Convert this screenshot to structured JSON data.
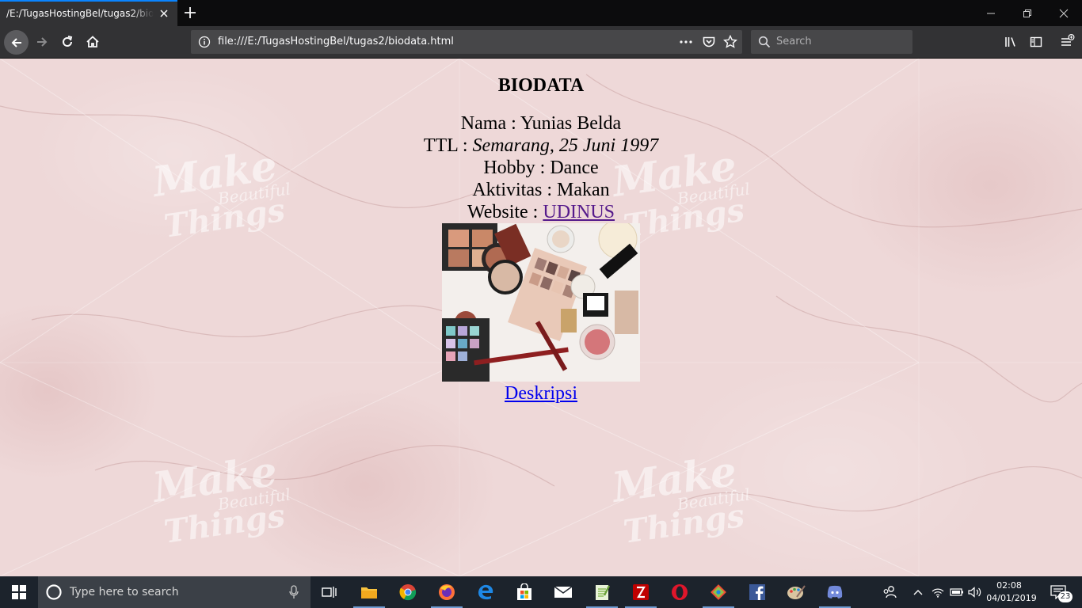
{
  "browser": {
    "tab_title": "/E:/TugasHostingBel/tugas2/biodata.html",
    "url": "file:///E:/TugasHostingBel/tugas2/biodata.html",
    "search_placeholder": "Search",
    "accent_color": "#0a84ff"
  },
  "page": {
    "title": "BIODATA",
    "nama_label": "Nama : ",
    "nama_value": "Yunias Belda",
    "ttl_label": "TTL : ",
    "ttl_value": "Semarang, 25 Juni 1997",
    "hobby_label": "Hobby : ",
    "hobby_value": "Dance",
    "aktivitas_label": "Aktivitas : ",
    "aktivitas_value": "Makan",
    "website_label": "Website : ",
    "website_link": "UDINUS",
    "image_alt": "makeup products",
    "deskripsi_link": "Deskripsi",
    "watermark": {
      "make": "Make",
      "beautiful": "Beautiful",
      "things": "Things"
    }
  },
  "taskbar": {
    "search_placeholder": "Type here to search",
    "time": "02:08",
    "date": "04/01/2019",
    "notification_count": "23",
    "pinned_apps": [
      "task-view",
      "file-explorer",
      "chrome",
      "firefox",
      "edge",
      "store",
      "mail",
      "notepad-plus",
      "filezilla",
      "opera",
      "git",
      "facebook",
      "paint",
      "discord"
    ]
  }
}
